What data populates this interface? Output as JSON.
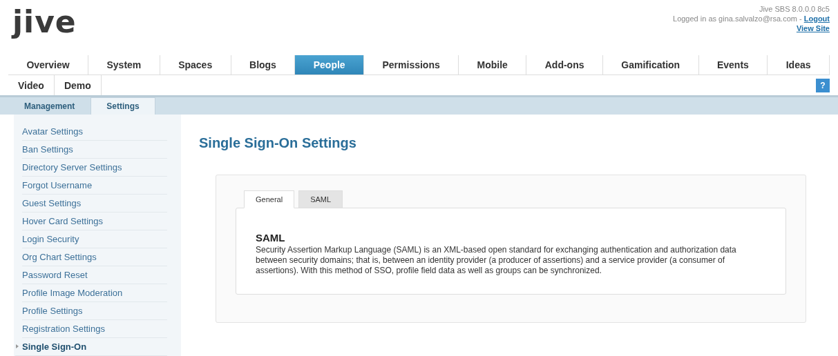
{
  "header": {
    "logo": "jive",
    "version": "Jive SBS 8.0.0.0 8c5",
    "logged_in": "Logged in as gina.salvalzo@rsa.com - ",
    "logout": "Logout",
    "view_site": "View Site"
  },
  "nav_rows": [
    [
      {
        "label": "Overview",
        "selected": false
      },
      {
        "label": "System",
        "selected": false
      },
      {
        "label": "Spaces",
        "selected": false
      },
      {
        "label": "Blogs",
        "selected": false
      },
      {
        "label": "People",
        "selected": true
      },
      {
        "label": "Permissions",
        "selected": false
      },
      {
        "label": "Mobile",
        "selected": false
      },
      {
        "label": "Add-ons",
        "selected": false
      },
      {
        "label": "Gamification",
        "selected": false
      },
      {
        "label": "Events",
        "selected": false
      },
      {
        "label": "Ideas",
        "selected": false
      }
    ],
    [
      {
        "label": "Video",
        "selected": false
      },
      {
        "label": "Demo",
        "selected": false
      }
    ]
  ],
  "help_button": "?",
  "sub_tabs": [
    {
      "label": "Management",
      "selected": false
    },
    {
      "label": "Settings",
      "selected": true
    }
  ],
  "sidebar": {
    "items": [
      {
        "label": "Avatar Settings",
        "selected": false
      },
      {
        "label": "Ban Settings",
        "selected": false
      },
      {
        "label": "Directory Server Settings",
        "selected": false
      },
      {
        "label": "Forgot Username",
        "selected": false
      },
      {
        "label": "Guest Settings",
        "selected": false
      },
      {
        "label": "Hover Card Settings",
        "selected": false
      },
      {
        "label": "Login Security",
        "selected": false
      },
      {
        "label": "Org Chart Settings",
        "selected": false
      },
      {
        "label": "Password Reset",
        "selected": false
      },
      {
        "label": "Profile Image Moderation",
        "selected": false
      },
      {
        "label": "Profile Settings",
        "selected": false
      },
      {
        "label": "Registration Settings",
        "selected": false
      },
      {
        "label": "Single Sign-On",
        "selected": true
      }
    ]
  },
  "main": {
    "title": "Single Sign-On Settings",
    "tabs": [
      {
        "label": "General",
        "selected": true
      },
      {
        "label": "SAML",
        "selected": false
      }
    ],
    "section_heading": "SAML",
    "description": "Security Assertion Markup Language (SAML) is an XML-based open standard for exchanging authentication and authorization data between security domains; that is, between an identity provider (a producer of assertions) and a service provider (a consumer of assertions). With this method of SSO, profile field data as well as groups can be synchronized."
  }
}
